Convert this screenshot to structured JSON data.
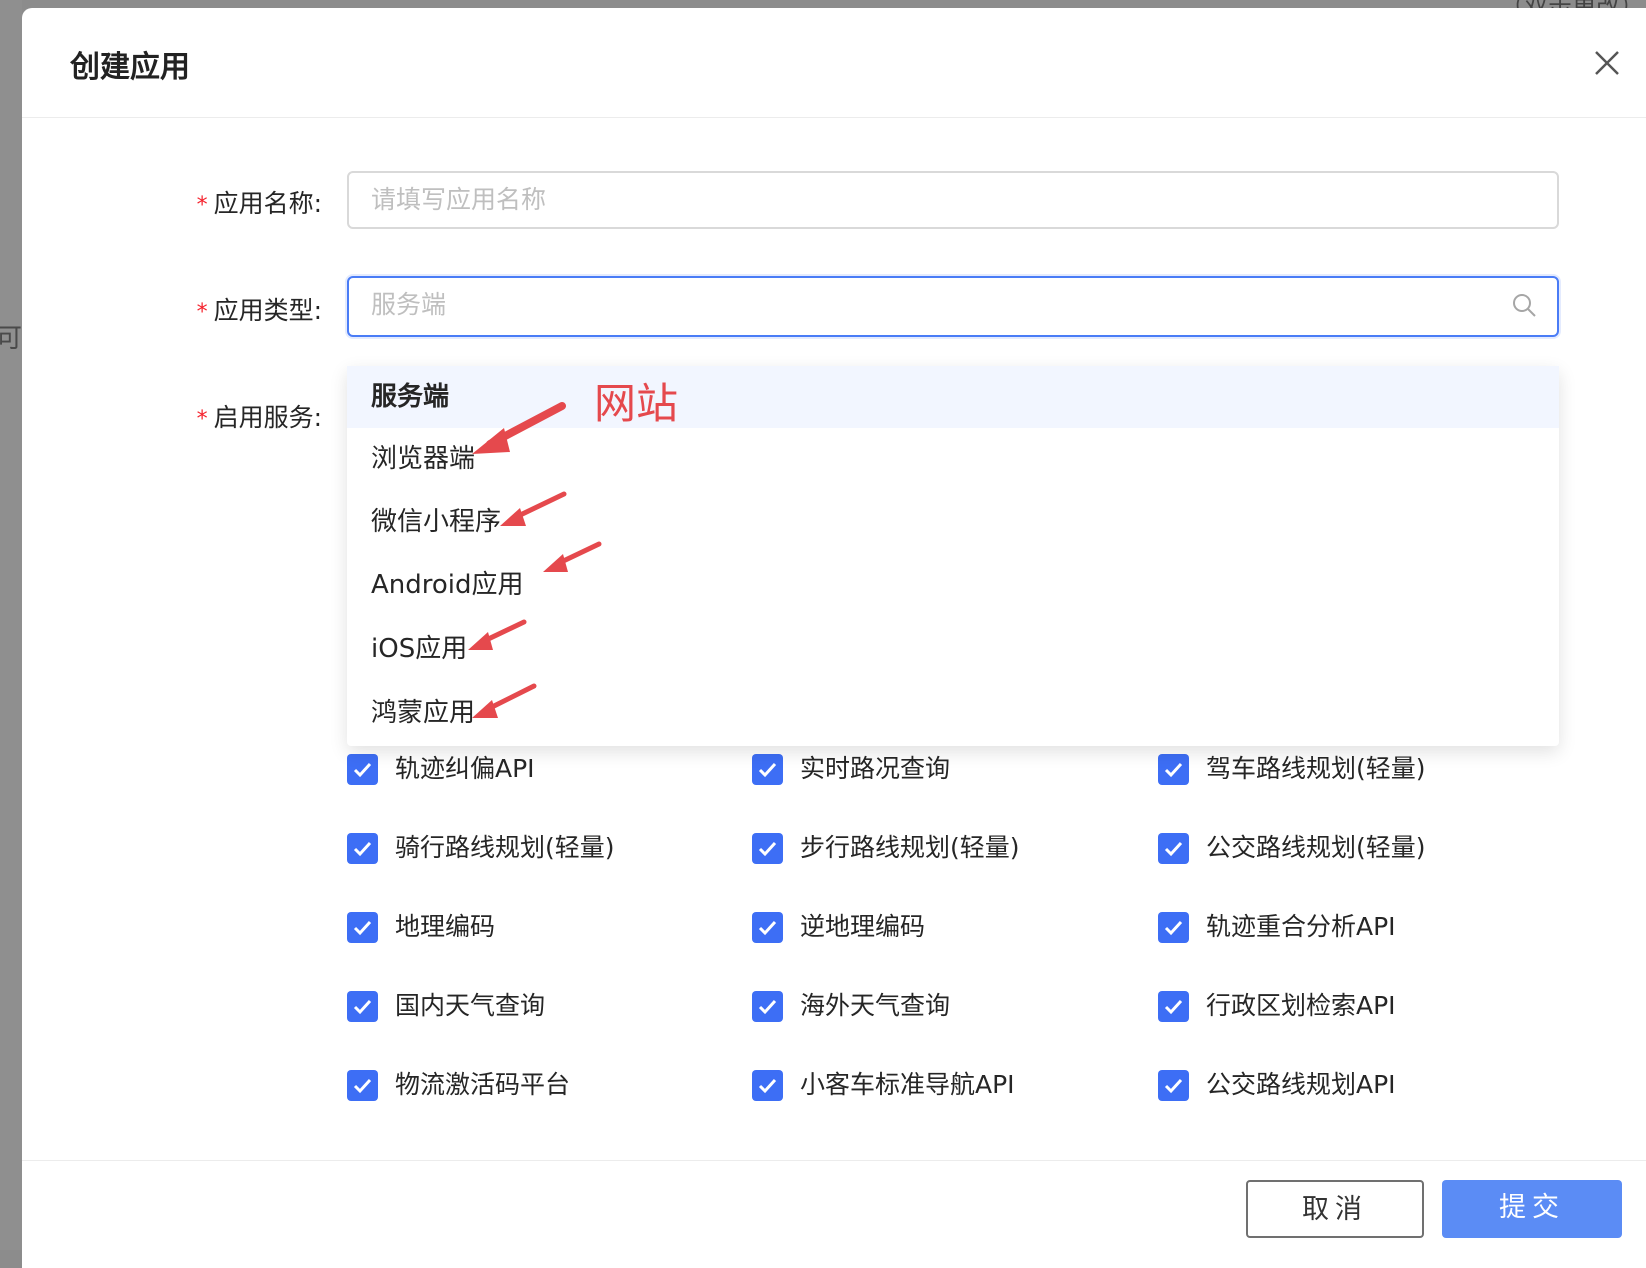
{
  "background": {
    "left_fragment": "可创",
    "top_fragment": "（双击更改）"
  },
  "modal": {
    "title": "创建应用"
  },
  "form": {
    "required_mark": "*",
    "name_label": "应用名称:",
    "name_placeholder": "请填写应用名称",
    "type_label": "应用类型:",
    "type_placeholder": "服务端",
    "services_label": "启用服务:"
  },
  "dropdown": {
    "options": [
      "服务端",
      "浏览器端",
      "微信小程序",
      "Android应用",
      "iOS应用",
      "鸿蒙应用"
    ],
    "selected": "服务端"
  },
  "annotation": {
    "text": "网站",
    "color": "#e5494d"
  },
  "services": [
    "轨迹纠偏API",
    "实时路况查询",
    "驾车路线规划(轻量)",
    "骑行路线规划(轻量)",
    "步行路线规划(轻量)",
    "公交路线规划(轻量)",
    "地理编码",
    "逆地理编码",
    "轨迹重合分析API",
    "国内天气查询",
    "海外天气查询",
    "行政区划检索API",
    "物流激活码平台",
    "小客车标准导航API",
    "公交路线规划API"
  ],
  "footer": {
    "cancel_label": "取消",
    "submit_label": "提交"
  },
  "colors": {
    "accent": "#3d6ef5",
    "submit": "#5b8cf5",
    "required": "#f5222d"
  }
}
